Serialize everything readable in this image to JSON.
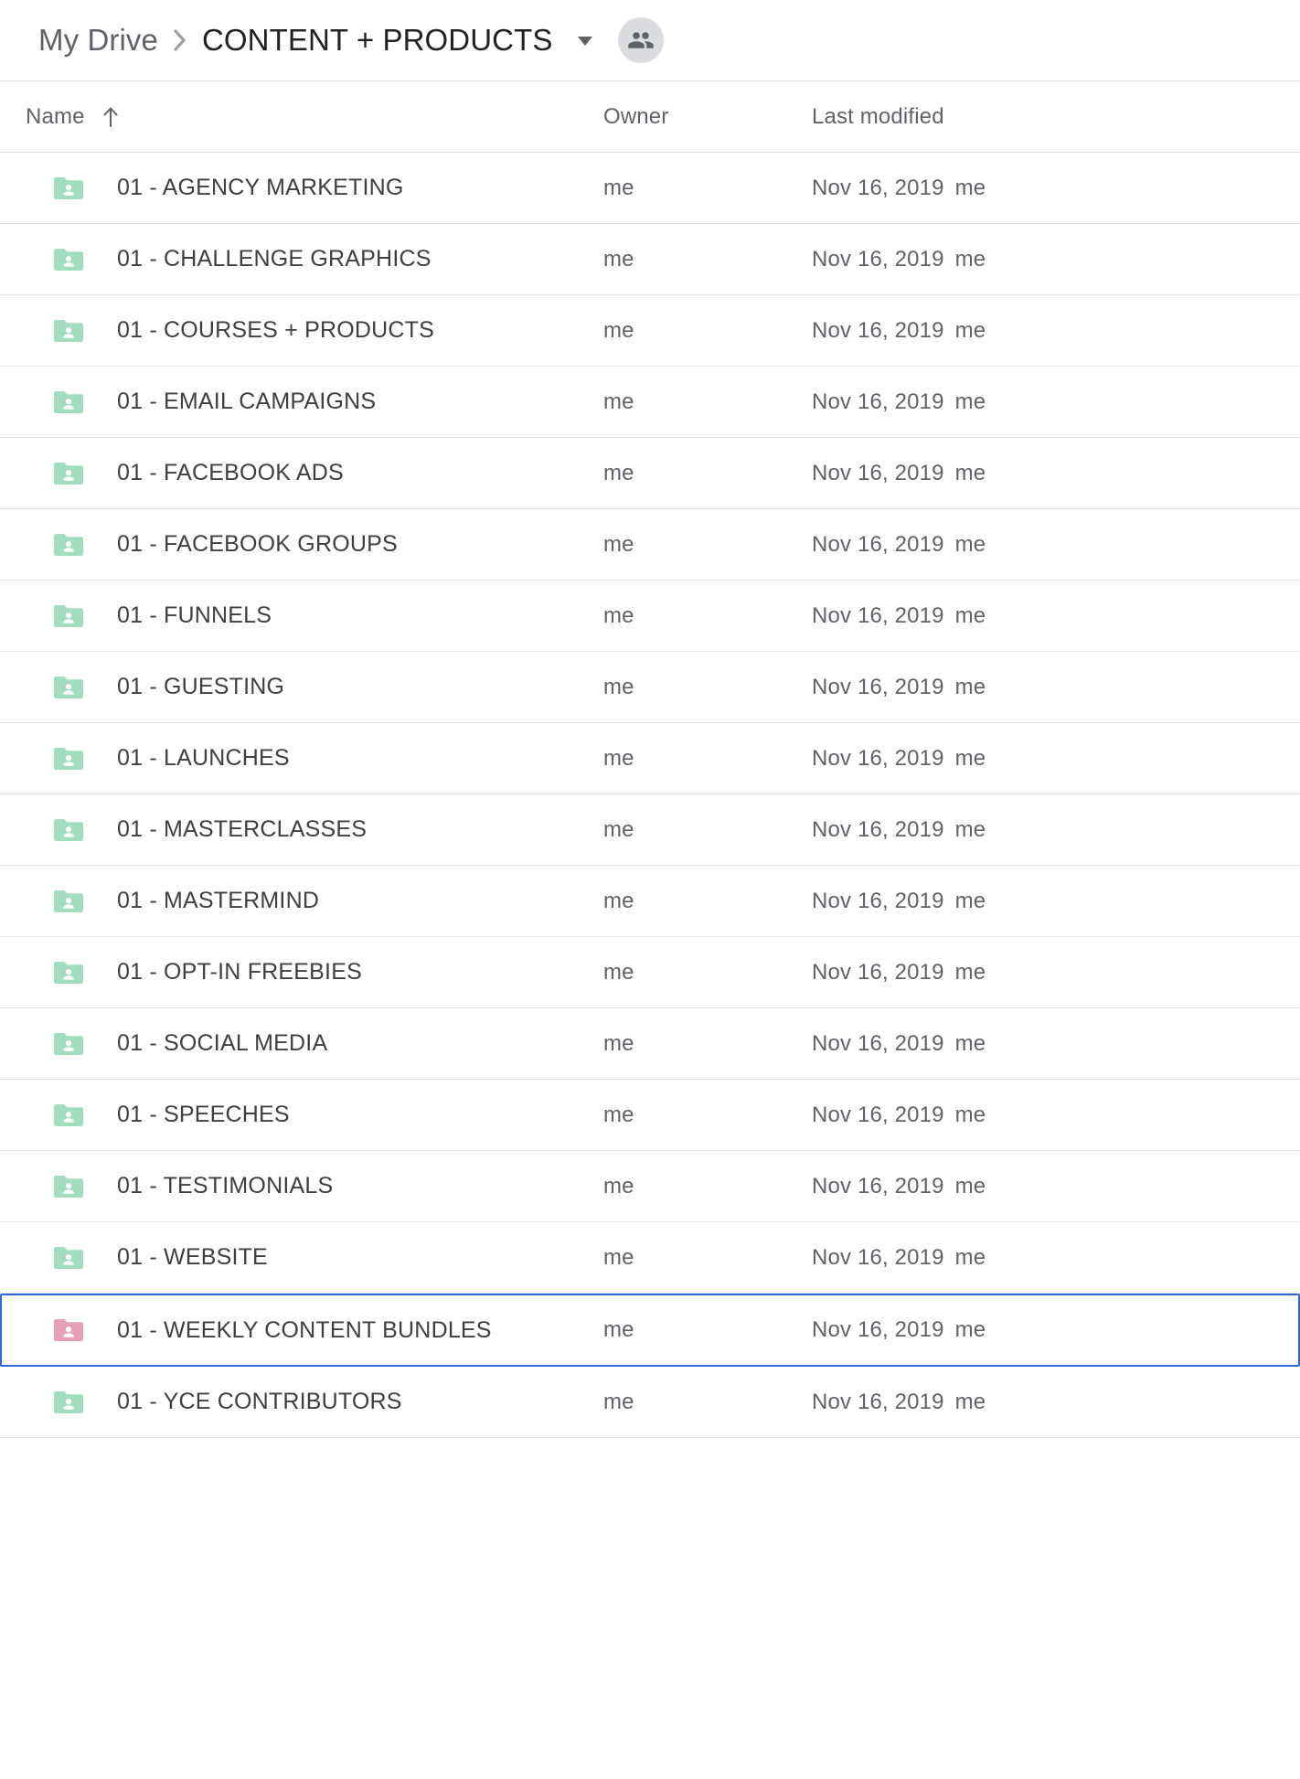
{
  "breadcrumb": {
    "parent": "My Drive",
    "separator_icon": "chevron-right-icon",
    "current": "CONTENT + PRODUCTS",
    "caret_icon": "chevron-down-icon",
    "share_icon": "people-shared-icon"
  },
  "columns": {
    "name": "Name",
    "sort_icon": "arrow-up-icon",
    "owner": "Owner",
    "last_modified": "Last modified"
  },
  "colors": {
    "folder_green": "#a3ddc0",
    "folder_pink": "#e8a0b8",
    "selection_blue": "#3367d6",
    "text_primary": "#3c4043",
    "text_secondary": "#5f6368"
  },
  "rows": [
    {
      "name": "01 - AGENCY MARKETING",
      "owner": "me",
      "modified": "Nov 16, 2019",
      "modified_by": "me",
      "icon": "folder-shared-icon",
      "color": "green",
      "selected": false
    },
    {
      "name": "01 - CHALLENGE GRAPHICS",
      "owner": "me",
      "modified": "Nov 16, 2019",
      "modified_by": "me",
      "icon": "folder-shared-icon",
      "color": "green",
      "selected": false
    },
    {
      "name": "01 - COURSES + PRODUCTS",
      "owner": "me",
      "modified": "Nov 16, 2019",
      "modified_by": "me",
      "icon": "folder-shared-icon",
      "color": "green",
      "selected": false
    },
    {
      "name": "01 - EMAIL CAMPAIGNS",
      "owner": "me",
      "modified": "Nov 16, 2019",
      "modified_by": "me",
      "icon": "folder-shared-icon",
      "color": "green",
      "selected": false
    },
    {
      "name": "01 - FACEBOOK ADS",
      "owner": "me",
      "modified": "Nov 16, 2019",
      "modified_by": "me",
      "icon": "folder-shared-icon",
      "color": "green",
      "selected": false
    },
    {
      "name": "01 - FACEBOOK GROUPS",
      "owner": "me",
      "modified": "Nov 16, 2019",
      "modified_by": "me",
      "icon": "folder-shared-icon",
      "color": "green",
      "selected": false
    },
    {
      "name": "01 - FUNNELS",
      "owner": "me",
      "modified": "Nov 16, 2019",
      "modified_by": "me",
      "icon": "folder-shared-icon",
      "color": "green",
      "selected": false
    },
    {
      "name": "01 - GUESTING",
      "owner": "me",
      "modified": "Nov 16, 2019",
      "modified_by": "me",
      "icon": "folder-shared-icon",
      "color": "green",
      "selected": false
    },
    {
      "name": "01 - LAUNCHES",
      "owner": "me",
      "modified": "Nov 16, 2019",
      "modified_by": "me",
      "icon": "folder-shared-icon",
      "color": "green",
      "selected": false
    },
    {
      "name": "01 - MASTERCLASSES",
      "owner": "me",
      "modified": "Nov 16, 2019",
      "modified_by": "me",
      "icon": "folder-shared-icon",
      "color": "green",
      "selected": false
    },
    {
      "name": "01 - MASTERMIND",
      "owner": "me",
      "modified": "Nov 16, 2019",
      "modified_by": "me",
      "icon": "folder-shared-icon",
      "color": "green",
      "selected": false
    },
    {
      "name": "01 - OPT-IN FREEBIES",
      "owner": "me",
      "modified": "Nov 16, 2019",
      "modified_by": "me",
      "icon": "folder-shared-icon",
      "color": "green",
      "selected": false
    },
    {
      "name": "01 - SOCIAL MEDIA",
      "owner": "me",
      "modified": "Nov 16, 2019",
      "modified_by": "me",
      "icon": "folder-shared-icon",
      "color": "green",
      "selected": false
    },
    {
      "name": "01 - SPEECHES",
      "owner": "me",
      "modified": "Nov 16, 2019",
      "modified_by": "me",
      "icon": "folder-shared-icon",
      "color": "green",
      "selected": false
    },
    {
      "name": "01 - TESTIMONIALS",
      "owner": "me",
      "modified": "Nov 16, 2019",
      "modified_by": "me",
      "icon": "folder-shared-icon",
      "color": "green",
      "selected": false
    },
    {
      "name": "01 - WEBSITE",
      "owner": "me",
      "modified": "Nov 16, 2019",
      "modified_by": "me",
      "icon": "folder-shared-icon",
      "color": "green",
      "selected": false
    },
    {
      "name": "01 - WEEKLY CONTENT BUNDLES",
      "owner": "me",
      "modified": "Nov 16, 2019",
      "modified_by": "me",
      "icon": "folder-shared-icon",
      "color": "pink",
      "selected": true
    },
    {
      "name": "01 - YCE CONTRIBUTORS",
      "owner": "me",
      "modified": "Nov 16, 2019",
      "modified_by": "me",
      "icon": "folder-shared-icon",
      "color": "green",
      "selected": false
    }
  ]
}
